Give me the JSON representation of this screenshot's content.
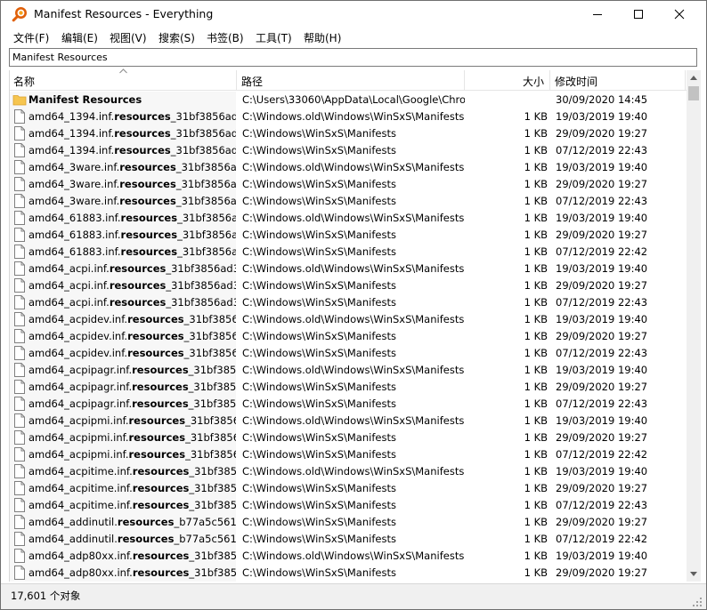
{
  "window": {
    "title": "Manifest Resources - Everything",
    "icon": "magnifier-icon"
  },
  "menu": [
    {
      "label": "文件(F)"
    },
    {
      "label": "编辑(E)"
    },
    {
      "label": "视图(V)"
    },
    {
      "label": "搜索(S)"
    },
    {
      "label": "书签(B)"
    },
    {
      "label": "工具(T)"
    },
    {
      "label": "帮助(H)"
    }
  ],
  "search": {
    "value": "Manifest Resources",
    "placeholder": ""
  },
  "columns": {
    "name": "名称",
    "path": "路径",
    "size": "大小",
    "modified": "修改时间"
  },
  "sort": {
    "column": "name",
    "direction": "ascending"
  },
  "rows": [
    {
      "type": "folder",
      "name_pre": "Manifest Resources",
      "name_bold": "",
      "name_post": "",
      "path": "C:\\Users\\33060\\AppData\\Local\\Google\\Chro...",
      "size": "",
      "date": "30/09/2020 14:45"
    },
    {
      "type": "file",
      "name_pre": "amd64_1394.inf.",
      "name_bold": "resources",
      "name_post": "_31bf3856ad364...",
      "path": "C:\\Windows.old\\Windows\\WinSxS\\Manifests",
      "size": "1 KB",
      "date": "19/03/2019 19:40"
    },
    {
      "type": "file",
      "name_pre": "amd64_1394.inf.",
      "name_bold": "resources",
      "name_post": "_31bf3856ad364...",
      "path": "C:\\Windows\\WinSxS\\Manifests",
      "size": "1 KB",
      "date": "29/09/2020 19:27"
    },
    {
      "type": "file",
      "name_pre": "amd64_1394.inf.",
      "name_bold": "resources",
      "name_post": "_31bf3856ad364...",
      "path": "C:\\Windows\\WinSxS\\Manifests",
      "size": "1 KB",
      "date": "07/12/2019 22:43"
    },
    {
      "type": "file",
      "name_pre": "amd64_3ware.inf.",
      "name_bold": "resources",
      "name_post": "_31bf3856ad36...",
      "path": "C:\\Windows.old\\Windows\\WinSxS\\Manifests",
      "size": "1 KB",
      "date": "19/03/2019 19:40"
    },
    {
      "type": "file",
      "name_pre": "amd64_3ware.inf.",
      "name_bold": "resources",
      "name_post": "_31bf3856ad36...",
      "path": "C:\\Windows\\WinSxS\\Manifests",
      "size": "1 KB",
      "date": "29/09/2020 19:27"
    },
    {
      "type": "file",
      "name_pre": "amd64_3ware.inf.",
      "name_bold": "resources",
      "name_post": "_31bf3856ad36...",
      "path": "C:\\Windows\\WinSxS\\Manifests",
      "size": "1 KB",
      "date": "07/12/2019 22:43"
    },
    {
      "type": "file",
      "name_pre": "amd64_61883.inf.",
      "name_bold": "resources",
      "name_post": "_31bf3856ad36...",
      "path": "C:\\Windows.old\\Windows\\WinSxS\\Manifests",
      "size": "1 KB",
      "date": "19/03/2019 19:40"
    },
    {
      "type": "file",
      "name_pre": "amd64_61883.inf.",
      "name_bold": "resources",
      "name_post": "_31bf3856ad36...",
      "path": "C:\\Windows\\WinSxS\\Manifests",
      "size": "1 KB",
      "date": "29/09/2020 19:27"
    },
    {
      "type": "file",
      "name_pre": "amd64_61883.inf.",
      "name_bold": "resources",
      "name_post": "_31bf3856ad36...",
      "path": "C:\\Windows\\WinSxS\\Manifests",
      "size": "1 KB",
      "date": "07/12/2019 22:42"
    },
    {
      "type": "file",
      "name_pre": "amd64_acpi.inf.",
      "name_bold": "resources",
      "name_post": "_31bf3856ad364...",
      "path": "C:\\Windows.old\\Windows\\WinSxS\\Manifests",
      "size": "1 KB",
      "date": "19/03/2019 19:40"
    },
    {
      "type": "file",
      "name_pre": "amd64_acpi.inf.",
      "name_bold": "resources",
      "name_post": "_31bf3856ad364...",
      "path": "C:\\Windows\\WinSxS\\Manifests",
      "size": "1 KB",
      "date": "29/09/2020 19:27"
    },
    {
      "type": "file",
      "name_pre": "amd64_acpi.inf.",
      "name_bold": "resources",
      "name_post": "_31bf3856ad364...",
      "path": "C:\\Windows\\WinSxS\\Manifests",
      "size": "1 KB",
      "date": "07/12/2019 22:43"
    },
    {
      "type": "file",
      "name_pre": "amd64_acpidev.inf.",
      "name_bold": "resources",
      "name_post": "_31bf3856ad...",
      "path": "C:\\Windows.old\\Windows\\WinSxS\\Manifests",
      "size": "1 KB",
      "date": "19/03/2019 19:40"
    },
    {
      "type": "file",
      "name_pre": "amd64_acpidev.inf.",
      "name_bold": "resources",
      "name_post": "_31bf3856ad...",
      "path": "C:\\Windows\\WinSxS\\Manifests",
      "size": "1 KB",
      "date": "29/09/2020 19:27"
    },
    {
      "type": "file",
      "name_pre": "amd64_acpidev.inf.",
      "name_bold": "resources",
      "name_post": "_31bf3856ad...",
      "path": "C:\\Windows\\WinSxS\\Manifests",
      "size": "1 KB",
      "date": "07/12/2019 22:43"
    },
    {
      "type": "file",
      "name_pre": "amd64_acpipagr.inf.",
      "name_bold": "resources",
      "name_post": "_31bf3856a...",
      "path": "C:\\Windows.old\\Windows\\WinSxS\\Manifests",
      "size": "1 KB",
      "date": "19/03/2019 19:40"
    },
    {
      "type": "file",
      "name_pre": "amd64_acpipagr.inf.",
      "name_bold": "resources",
      "name_post": "_31bf3856a...",
      "path": "C:\\Windows\\WinSxS\\Manifests",
      "size": "1 KB",
      "date": "29/09/2020 19:27"
    },
    {
      "type": "file",
      "name_pre": "amd64_acpipagr.inf.",
      "name_bold": "resources",
      "name_post": "_31bf3856a...",
      "path": "C:\\Windows\\WinSxS\\Manifests",
      "size": "1 KB",
      "date": "07/12/2019 22:43"
    },
    {
      "type": "file",
      "name_pre": "amd64_acpipmi.inf.",
      "name_bold": "resources",
      "name_post": "_31bf3856ad...",
      "path": "C:\\Windows.old\\Windows\\WinSxS\\Manifests",
      "size": "1 KB",
      "date": "19/03/2019 19:40"
    },
    {
      "type": "file",
      "name_pre": "amd64_acpipmi.inf.",
      "name_bold": "resources",
      "name_post": "_31bf3856ad...",
      "path": "C:\\Windows\\WinSxS\\Manifests",
      "size": "1 KB",
      "date": "29/09/2020 19:27"
    },
    {
      "type": "file",
      "name_pre": "amd64_acpipmi.inf.",
      "name_bold": "resources",
      "name_post": "_31bf3856ad...",
      "path": "C:\\Windows\\WinSxS\\Manifests",
      "size": "1 KB",
      "date": "07/12/2019 22:42"
    },
    {
      "type": "file",
      "name_pre": "amd64_acpitime.inf.",
      "name_bold": "resources",
      "name_post": "_31bf3856a...",
      "path": "C:\\Windows.old\\Windows\\WinSxS\\Manifests",
      "size": "1 KB",
      "date": "19/03/2019 19:40"
    },
    {
      "type": "file",
      "name_pre": "amd64_acpitime.inf.",
      "name_bold": "resources",
      "name_post": "_31bf3856a...",
      "path": "C:\\Windows\\WinSxS\\Manifests",
      "size": "1 KB",
      "date": "29/09/2020 19:27"
    },
    {
      "type": "file",
      "name_pre": "amd64_acpitime.inf.",
      "name_bold": "resources",
      "name_post": "_31bf3856a...",
      "path": "C:\\Windows\\WinSxS\\Manifests",
      "size": "1 KB",
      "date": "07/12/2019 22:43"
    },
    {
      "type": "file",
      "name_pre": "amd64_addinutil.",
      "name_bold": "resources",
      "name_post": "_b77a5c561934...",
      "path": "C:\\Windows\\WinSxS\\Manifests",
      "size": "1 KB",
      "date": "29/09/2020 19:27"
    },
    {
      "type": "file",
      "name_pre": "amd64_addinutil.",
      "name_bold": "resources",
      "name_post": "_b77a5c561934...",
      "path": "C:\\Windows\\WinSxS\\Manifests",
      "size": "1 KB",
      "date": "07/12/2019 22:42"
    },
    {
      "type": "file",
      "name_pre": "amd64_adp80xx.inf.",
      "name_bold": "resources",
      "name_post": "_31bf3856a...",
      "path": "C:\\Windows.old\\Windows\\WinSxS\\Manifests",
      "size": "1 KB",
      "date": "19/03/2019 19:40"
    },
    {
      "type": "file",
      "name_pre": "amd64_adp80xx.inf.",
      "name_bold": "resources",
      "name_post": "_31bf3856a...",
      "path": "C:\\Windows\\WinSxS\\Manifests",
      "size": "1 KB",
      "date": "29/09/2020 19:27"
    }
  ],
  "status": {
    "text": "17,601 个对象"
  },
  "colors": {
    "folder": "#f6c54f",
    "window_bg": "#ffffff",
    "statusbar": "#f0f0f0"
  }
}
